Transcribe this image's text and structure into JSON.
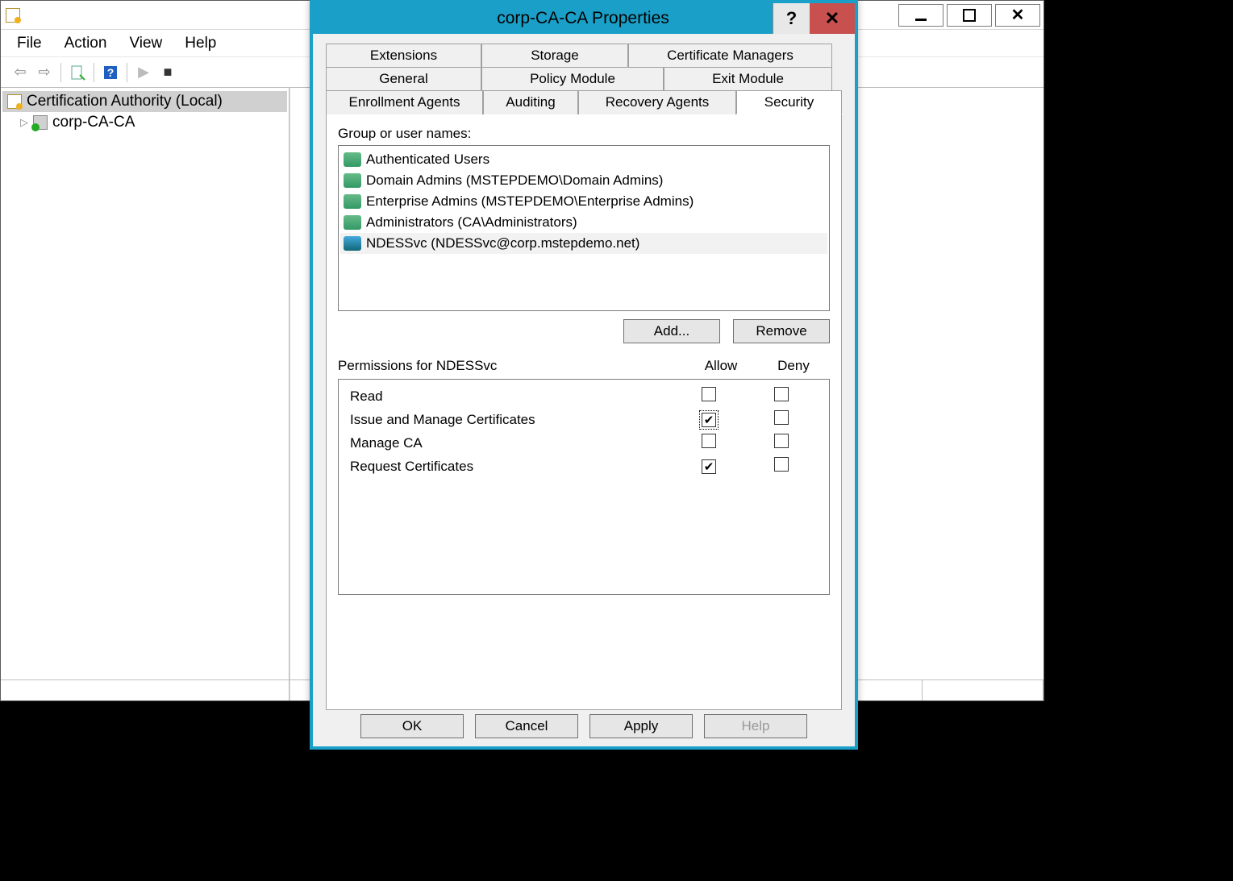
{
  "main_window": {
    "menus": [
      "File",
      "Action",
      "View",
      "Help"
    ],
    "tree": {
      "root": "Certification Authority (Local)",
      "child": "corp-CA-CA"
    }
  },
  "dialog": {
    "title": "corp-CA-CA Properties",
    "tabs_row1": [
      "Extensions",
      "Storage",
      "Certificate Managers"
    ],
    "tabs_row2": [
      "General",
      "Policy Module",
      "Exit Module"
    ],
    "tabs_row3": [
      "Enrollment Agents",
      "Auditing",
      "Recovery Agents",
      "Security"
    ],
    "selected_tab": "Security",
    "group_label": "Group or user names:",
    "groups": [
      {
        "name": "Authenticated Users",
        "type": "group",
        "selected": false
      },
      {
        "name": "Domain Admins (MSTEPDEMO\\Domain Admins)",
        "type": "group",
        "selected": false
      },
      {
        "name": "Enterprise Admins (MSTEPDEMO\\Enterprise Admins)",
        "type": "group",
        "selected": false
      },
      {
        "name": "Administrators (CA\\Administrators)",
        "type": "group",
        "selected": false
      },
      {
        "name": "NDESSvc (NDESSvc@corp.mstepdemo.net)",
        "type": "user",
        "selected": true
      }
    ],
    "add_label": "Add...",
    "remove_label": "Remove",
    "perm_header": "Permissions for NDESSvc",
    "allow_label": "Allow",
    "deny_label": "Deny",
    "permissions": [
      {
        "name": "Read",
        "allow": false,
        "deny": false,
        "focus": false
      },
      {
        "name": "Issue and Manage Certificates",
        "allow": true,
        "deny": false,
        "focus": true
      },
      {
        "name": "Manage CA",
        "allow": false,
        "deny": false,
        "focus": false
      },
      {
        "name": "Request Certificates",
        "allow": true,
        "deny": false,
        "focus": false
      }
    ],
    "footer": {
      "ok": "OK",
      "cancel": "Cancel",
      "apply": "Apply",
      "help": "Help"
    }
  }
}
